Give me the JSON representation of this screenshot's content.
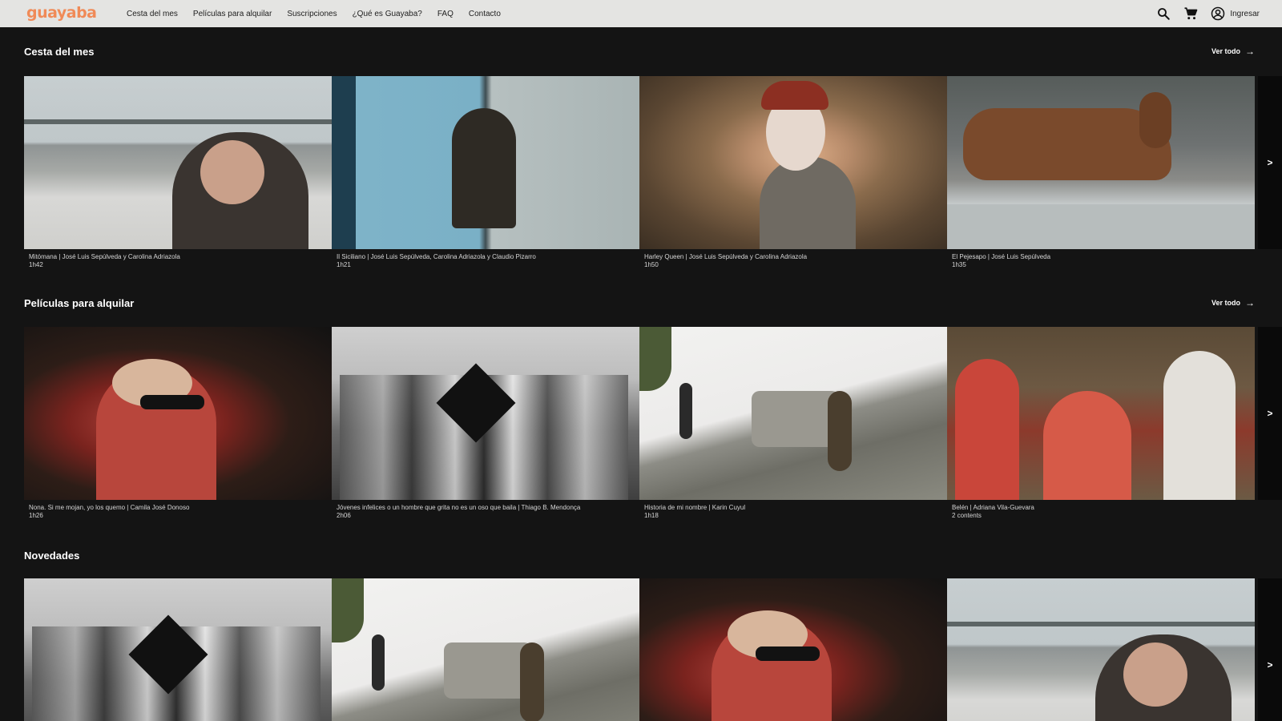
{
  "brand": {
    "logo": "guayaba",
    "accent": "#f08a57"
  },
  "nav": {
    "items": [
      "Cesta del mes",
      "Películas para alquilar",
      "Suscripciones",
      "¿Qué es Guayaba?",
      "FAQ",
      "Contacto"
    ],
    "login_label": "Ingresar"
  },
  "icons": {
    "search": "search-icon",
    "cart": "cart-icon",
    "account": "account-icon",
    "arrow": "arrow-right-icon",
    "next": "chevron-right-icon"
  },
  "sections": [
    {
      "title": "Cesta del mes",
      "view_all": "Ver todo",
      "cards": [
        {
          "caption": "Mitómana | José Luis Sepúlveda y Carolina Adriazola",
          "duration": "1h42"
        },
        {
          "caption": "Il Siciliano | José Luis Sepúlveda, Carolina Adriazola y Claudio Pizarro",
          "duration": "1h21"
        },
        {
          "caption": "Harley Queen | José Luis Sepúlveda y Carolina Adriazola",
          "duration": "1h50"
        },
        {
          "caption": "El Pejesapo | José Luis Sepúlveda",
          "duration": "1h35"
        }
      ]
    },
    {
      "title": "Películas para alquilar",
      "view_all": "Ver todo",
      "cards": [
        {
          "caption": "Nona. Si me mojan, yo los quemo | Camila José Donoso",
          "duration": "1h26"
        },
        {
          "caption": "Jóvenes infelices o un hombre que grita no es un oso que baila | Thiago B. Mendonça",
          "duration": "2h06"
        },
        {
          "caption": "Historia de mi nombre | Karin Cuyul",
          "duration": "1h18"
        },
        {
          "caption": "Belén | Adriana Vila-Guevara",
          "duration": "2 contents"
        }
      ]
    },
    {
      "title": "Novedades",
      "cards": [
        {
          "caption": "",
          "duration": ""
        },
        {
          "caption": "",
          "duration": ""
        },
        {
          "caption": "",
          "duration": ""
        },
        {
          "caption": "",
          "duration": ""
        }
      ]
    }
  ],
  "next_glyph": ">"
}
